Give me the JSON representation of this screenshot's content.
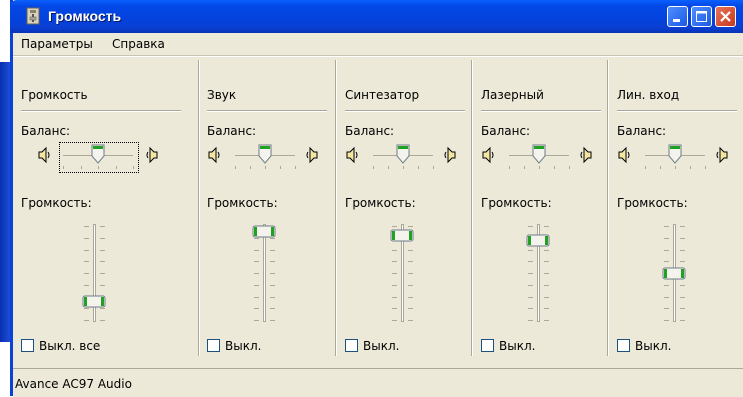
{
  "window": {
    "title": "Громкость"
  },
  "menu": {
    "items": [
      "Параметры",
      "Справка"
    ]
  },
  "columns": [
    {
      "name": "Громкость",
      "balance_label": "Баланс:",
      "volume_label": "Громкость:",
      "mute_label": "Выкл. все",
      "balance_level": 0.5,
      "volume_level": 0.2
    },
    {
      "name": "Звук",
      "balance_label": "Баланс:",
      "volume_label": "Громкость:",
      "mute_label": "Выкл.",
      "balance_level": 0.5,
      "volume_level": 0.95
    },
    {
      "name": "Синтезатор",
      "balance_label": "Баланс:",
      "volume_label": "Громкость:",
      "mute_label": "Выкл.",
      "balance_level": 0.5,
      "volume_level": 0.9
    },
    {
      "name": "Лазерный",
      "balance_label": "Баланс:",
      "volume_label": "Громкость:",
      "mute_label": "Выкл.",
      "balance_level": 0.5,
      "volume_level": 0.85
    },
    {
      "name": "Лин. вход",
      "balance_label": "Баланс:",
      "volume_label": "Громкость:",
      "mute_label": "Выкл.",
      "balance_level": 0.5,
      "volume_level": 0.5
    }
  ],
  "status": {
    "text": "Avance AC97 Audio"
  },
  "colors": {
    "title_bar": "#0348e6",
    "window_bg": "#ece9d8",
    "thumb_accent": "#21a121",
    "close_button": "#c4391f"
  }
}
